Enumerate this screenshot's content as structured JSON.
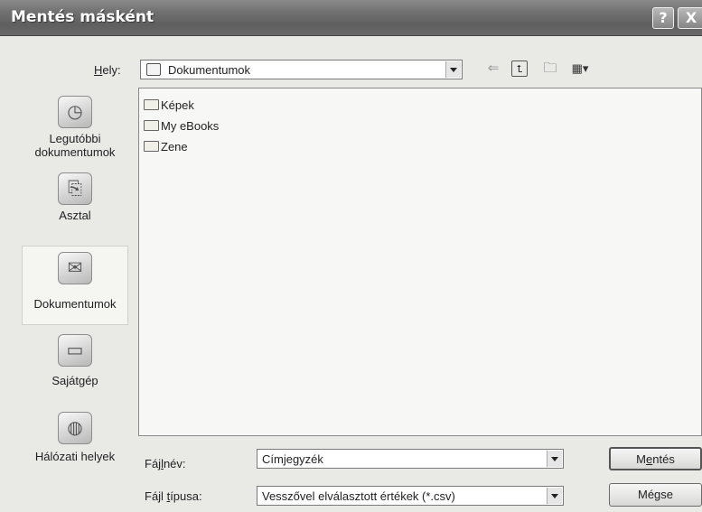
{
  "window": {
    "title": "Mentés másként",
    "help_glyph": "?",
    "close_glyph": "X"
  },
  "location": {
    "label_prefix": "",
    "label_accel": "H",
    "label_rest": "ely:",
    "value": "Dokumentumok"
  },
  "places": [
    {
      "label_line1": "Legutóbbi",
      "label_line2": "dokumentumok",
      "icon": "recent-documents-icon"
    },
    {
      "label_line1": "Asztal",
      "label_line2": "",
      "icon": "desktop-icon"
    },
    {
      "label_line1": "Dokumentumok",
      "label_line2": "",
      "icon": "my-documents-icon"
    },
    {
      "label_line1": "Sajátgép",
      "label_line2": "",
      "icon": "my-computer-icon"
    },
    {
      "label_line1": "Hálózati helyek",
      "label_line2": "",
      "icon": "network-places-icon"
    }
  ],
  "files": [
    {
      "name": "Képek",
      "icon": "pictures-folder-icon"
    },
    {
      "name": "My eBooks",
      "icon": "folder-icon"
    },
    {
      "name": "Zene",
      "icon": "music-folder-icon"
    }
  ],
  "filename": {
    "label_prefix": "Fáj",
    "label_accel": "l",
    "label_mid": "",
    "label_rest": "név:",
    "value": "Címjegyzék"
  },
  "filetype": {
    "label_prefix": "Fájl ",
    "label_accel": "t",
    "label_rest": "ípusa:",
    "value": "Vesszővel elválasztott értékek (*.csv)"
  },
  "buttons": {
    "save_prefix": "M",
    "save_accel": "e",
    "save_rest": "ntés",
    "cancel": "Mégse"
  }
}
